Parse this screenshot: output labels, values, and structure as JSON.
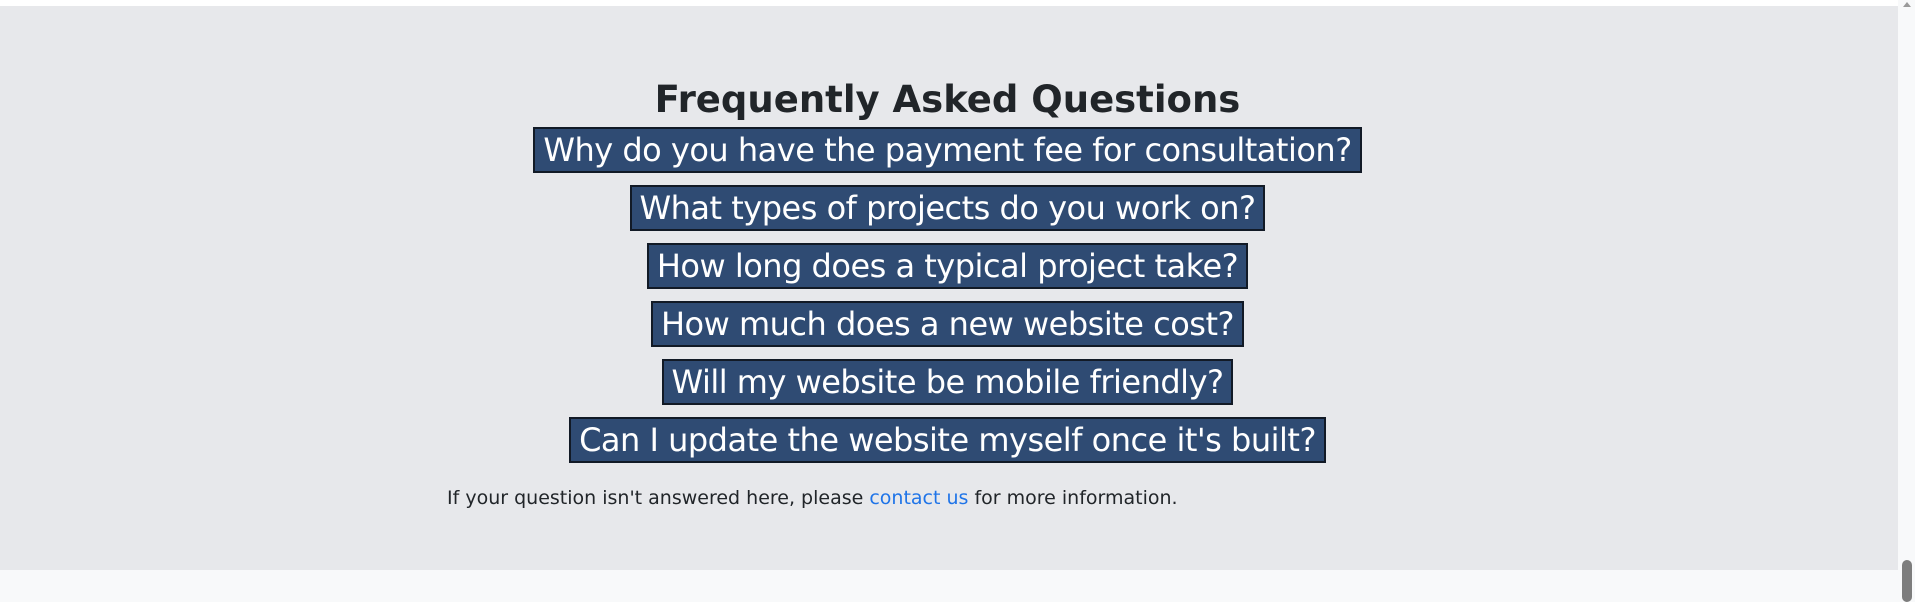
{
  "faq": {
    "title": "Frequently Asked Questions",
    "questions": [
      "Why do you have the payment fee for consultation?",
      "What types of projects do you work on?",
      "How long does a typical project take?",
      "How much does a new website cost?",
      "Will my website be mobile friendly?",
      "Can I update the website myself once it's built?"
    ],
    "note": {
      "prefix": "If your question isn't answered here, please ",
      "link_text": "contact us",
      "suffix": " for more information."
    }
  },
  "colors": {
    "section_bg": "#e7e8eb",
    "question_bg": "#2f4b73",
    "link": "#1f74e8"
  },
  "icons": {
    "scroll_up": "scroll-up-arrow-icon"
  }
}
